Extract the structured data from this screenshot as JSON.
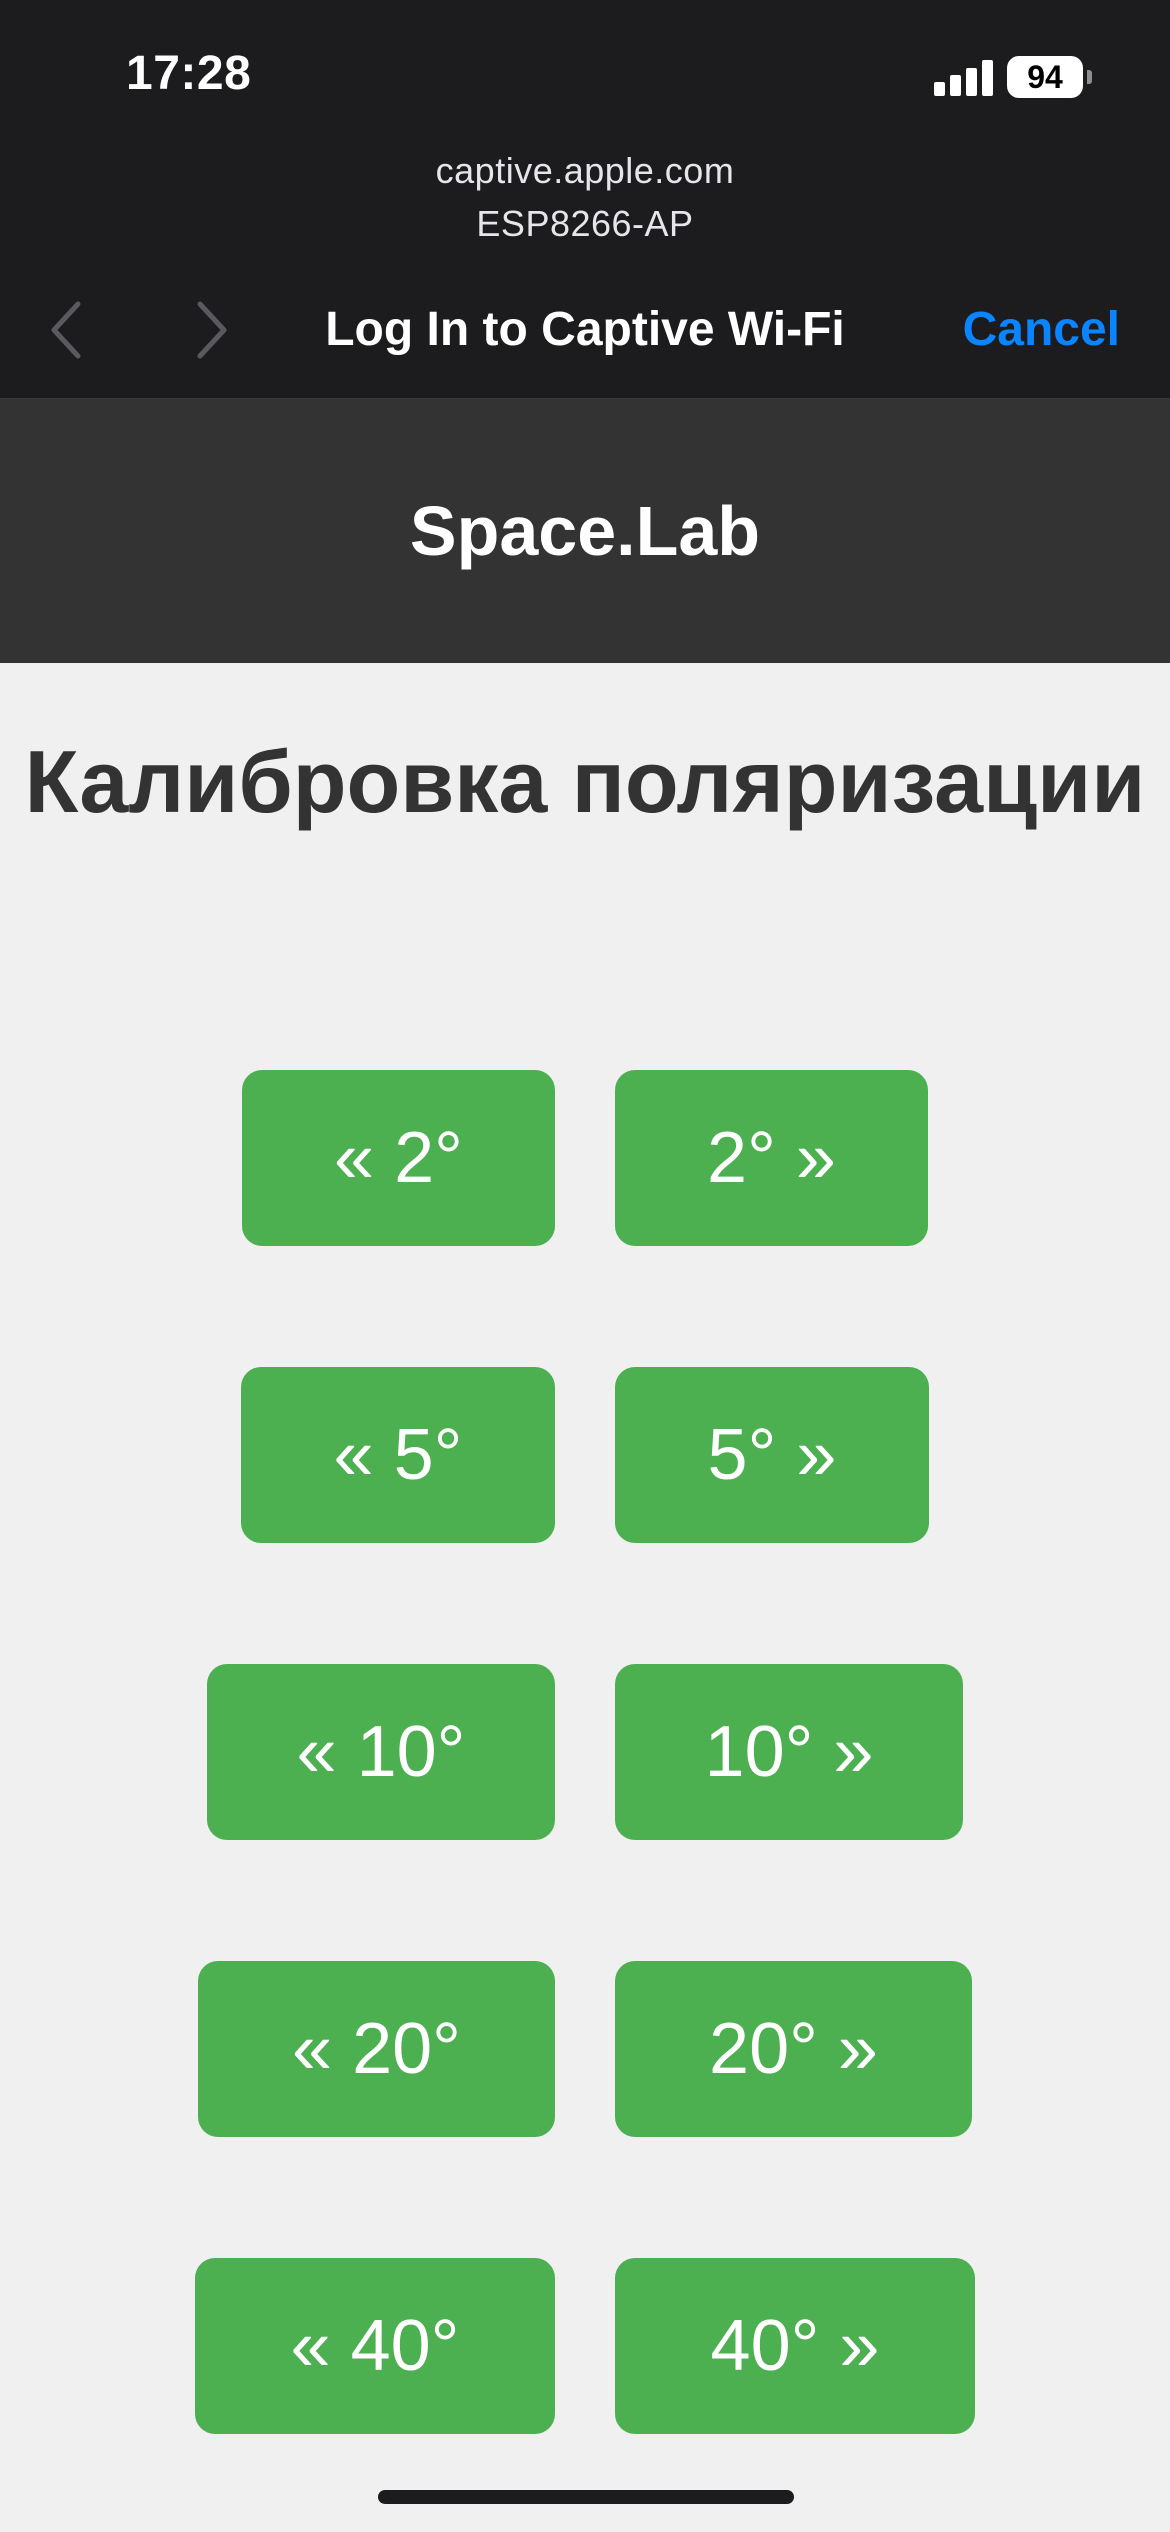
{
  "status_bar": {
    "time": "17:28",
    "battery": "94",
    "icons": [
      "cellular-signal-icon",
      "battery-icon"
    ]
  },
  "browser": {
    "url": "captive.apple.com",
    "network": "ESP8266-AP",
    "title": "Log In to Captive Wi-Fi",
    "cancel_label": "Cancel",
    "back_icon": "chevron-left-icon",
    "forward_icon": "chevron-right-icon"
  },
  "header": {
    "brand": "Space.Lab"
  },
  "main": {
    "title": "Калибровка поляризации",
    "buttons": [
      {
        "left": "« 2°",
        "right": "2° »"
      },
      {
        "left": "« 5°",
        "right": "5° »"
      },
      {
        "left": "« 10°",
        "right": "10° »"
      },
      {
        "left": "« 20°",
        "right": "20° »"
      },
      {
        "left": "« 40°",
        "right": "40° »"
      }
    ]
  },
  "colors": {
    "button_green": "#4caf50",
    "header_dark": "#333333",
    "chrome_dark": "#1c1c1e",
    "link_blue": "#0a84ff",
    "page_bg": "#f0f0f0"
  }
}
